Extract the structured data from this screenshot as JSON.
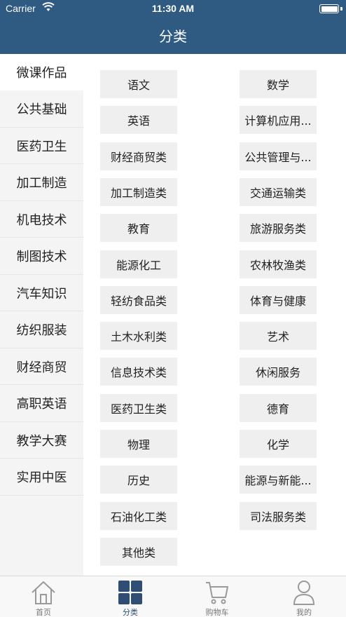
{
  "status": {
    "carrier": "Carrier",
    "time": "11:30 AM"
  },
  "nav": {
    "title": "分类"
  },
  "sidebar": {
    "items": [
      {
        "label": "微课作品",
        "active": true
      },
      {
        "label": "公共基础"
      },
      {
        "label": "医药卫生"
      },
      {
        "label": "加工制造"
      },
      {
        "label": "机电技术"
      },
      {
        "label": "制图技术"
      },
      {
        "label": "汽车知识"
      },
      {
        "label": "纺织服装"
      },
      {
        "label": "财经商贸"
      },
      {
        "label": "高职英语"
      },
      {
        "label": "教学大赛"
      },
      {
        "label": "实用中医"
      }
    ]
  },
  "categories": [
    "语文",
    "数学",
    "英语",
    "计算机应用...",
    "财经商贸类",
    "公共管理与...",
    "加工制造类",
    "交通运输类",
    "教育",
    "旅游服务类",
    "能源化工",
    "农林牧渔类",
    "轻纺食品类",
    "体育与健康",
    "土木水利类",
    "艺术",
    "信息技术类",
    "休闲服务",
    "医药卫生类",
    "德育",
    "物理",
    "化学",
    "历史",
    "能源与新能...",
    "石油化工类",
    "司法服务类",
    "其他类"
  ],
  "tabbar": {
    "items": [
      {
        "label": "首页",
        "icon": "home-icon"
      },
      {
        "label": "分类",
        "icon": "grid-icon",
        "active": true
      },
      {
        "label": "购物车",
        "icon": "cart-icon"
      },
      {
        "label": "我的",
        "icon": "user-icon"
      }
    ]
  },
  "colors": {
    "nav": "#2f5a82",
    "active_tab": "#2f4d75",
    "button_bg": "#efefef"
  }
}
